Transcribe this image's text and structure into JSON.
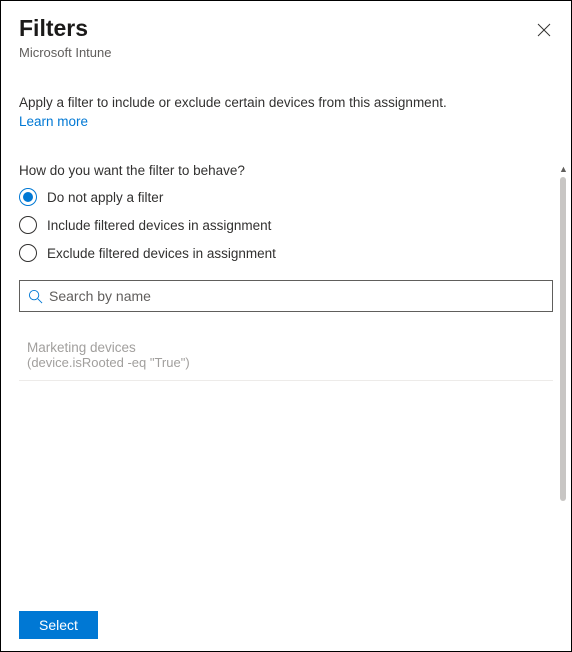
{
  "header": {
    "title": "Filters",
    "subtitle": "Microsoft Intune"
  },
  "intro": {
    "text": "Apply a filter to include or exclude certain devices from this assignment.",
    "learn_more": "Learn more"
  },
  "form": {
    "question": "How do you want the filter to behave?",
    "options": [
      {
        "label": "Do not apply a filter",
        "selected": true
      },
      {
        "label": "Include filtered devices in assignment",
        "selected": false
      },
      {
        "label": "Exclude filtered devices in assignment",
        "selected": false
      }
    ],
    "search_placeholder": "Search by name"
  },
  "filters": [
    {
      "name": "Marketing devices",
      "expr": "(device.isRooted -eq \"True\")"
    }
  ],
  "footer": {
    "select_label": "Select"
  }
}
